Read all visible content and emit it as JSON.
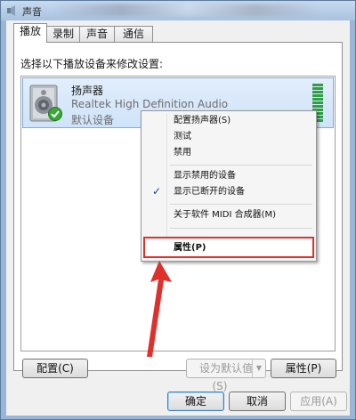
{
  "window": {
    "title": "声音"
  },
  "tabs": [
    {
      "label": "播放",
      "active": true
    },
    {
      "label": "录制",
      "active": false
    },
    {
      "label": "声音",
      "active": false
    },
    {
      "label": "通信",
      "active": false
    }
  ],
  "instruction": "选择以下播放设备来修改设置:",
  "device": {
    "name": "扬声器",
    "description": "Realtek High Definition Audio",
    "status": "默认设备",
    "icon": "speaker-icon",
    "default_badge": "green-check-icon"
  },
  "context_menu": {
    "items": [
      {
        "label": "配置扬声器(S)",
        "checked": false
      },
      {
        "label": "测试",
        "checked": false
      },
      {
        "label": "禁用",
        "checked": false
      },
      {
        "label": "显示禁用的设备",
        "checked": false
      },
      {
        "label": "显示已断开的设备",
        "checked": true
      },
      {
        "label": "关于软件 MIDI 合成器(M)",
        "checked": false
      },
      {
        "label": "属性(P)",
        "checked": false,
        "highlighted": true
      }
    ],
    "highlight_color": "#e0302b"
  },
  "panel_buttons": {
    "configure": "配置(C)",
    "set_default": "设为默认值(S)",
    "properties": "属性(P)"
  },
  "dialog_buttons": {
    "ok": "确定",
    "cancel": "取消",
    "apply": "应用(A)"
  },
  "colors": {
    "selection": "#cfe3fa",
    "level_meter": "#2ea043",
    "annotation_arrow": "#e0302b"
  }
}
